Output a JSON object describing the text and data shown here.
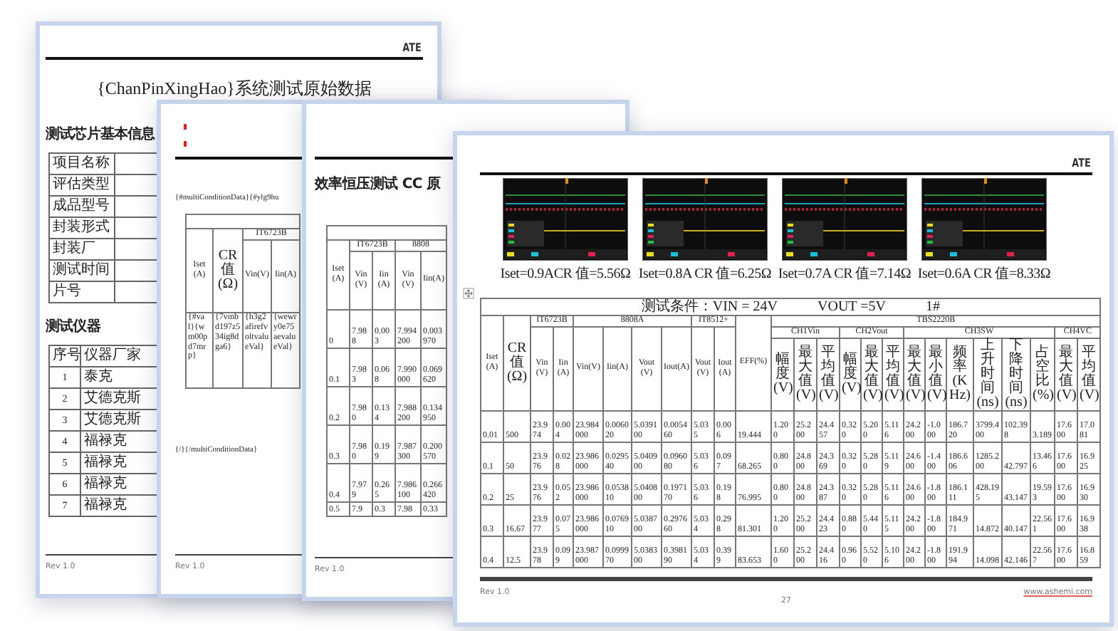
{
  "cover_page": {
    "header": "ATE",
    "title": "{ChanPinXingHao}系统测试原始数据",
    "chip_info": {
      "heading": "测试芯片基本信息",
      "rows": [
        {
          "label": "项目名称"
        },
        {
          "label": "评估类型"
        },
        {
          "label": "成品型号"
        },
        {
          "label": "封装形式"
        },
        {
          "label": "封装厂"
        },
        {
          "label": "测试时间"
        },
        {
          "label": "片号"
        }
      ]
    },
    "instruments": {
      "heading": "测试仪器",
      "columns": [
        "序号",
        "仪器厂家"
      ],
      "rows": [
        {
          "no": "1",
          "maker": "泰克"
        },
        {
          "no": "2",
          "maker": "艾德克斯"
        },
        {
          "no": "3",
          "maker": "艾德克斯"
        },
        {
          "no": "4",
          "maker": "福禄克"
        },
        {
          "no": "5",
          "maker": "福禄克"
        },
        {
          "no": "6",
          "maker": "福禄克"
        },
        {
          "no": "7",
          "maker": "福禄克"
        }
      ]
    },
    "footer": "Rev 1.0"
  },
  "template_page": {
    "loop_start": "{#multiConditionData}{#ylg9hu",
    "table": {
      "lead_columns": [
        "Iset(A)",
        "CR值(Ω)"
      ],
      "groups": [
        {
          "label": "IT6723B",
          "columns": [
            "Vin(V)",
            "Iin(A)"
          ]
        }
      ],
      "rows": [
        [
          "{#val}{wm00pd7mrp}",
          "{7vmbd197z534ig8dga6}",
          "{h3g2afirefvoltvalueVal}",
          "{wewry0e75aevalueVal}"
        ]
      ]
    },
    "loop_end": "{/}{/multiConditionData}",
    "footer": "Rev 1.0"
  },
  "cc_test_page": {
    "title": "效率恒压测试 CC 原",
    "table": {
      "lead_columns": [
        "Iset(A)"
      ],
      "groups": [
        {
          "label": "IT6723B",
          "columns": [
            "Vin(V)",
            "Iin(A)"
          ]
        },
        {
          "label": "8808",
          "columns": [
            "Vin(V)",
            "Iin(A)"
          ]
        }
      ],
      "rows": [
        [
          "0",
          "7.988",
          "0.003",
          "7.994200",
          "0.003970"
        ],
        [
          "0.1",
          "7.983",
          "0.068",
          "7.990000",
          "0.069620"
        ],
        [
          "0.2",
          "7.980",
          "0.134",
          "7.988200",
          "0.134950"
        ],
        [
          "0.3",
          "7.980",
          "0.199",
          "7.987300",
          "0.200570"
        ],
        [
          "0.4",
          "7.979",
          "0.265",
          "7.986100",
          "0.266420"
        ],
        [
          "0.5",
          "7.9",
          "0.3",
          "7.98",
          "0.33"
        ]
      ]
    },
    "footer": "Rev 1.0"
  },
  "result_page": {
    "header": "ATE",
    "captures": [
      {
        "caption": "Iset=0.9ACR 值=5.56Ω"
      },
      {
        "caption": "Iset=0.8A CR 值=6.25Ω"
      },
      {
        "caption": "Iset=0.7A CR 值=7.14Ω"
      },
      {
        "caption": "Iset=0.6A CR 值=8.33Ω"
      }
    ],
    "table": {
      "condition": [
        "测试条件：VIN = 24V",
        "VOUT =5V",
        "1#"
      ],
      "lead_columns": [
        "Iset(A)",
        "CR值(Ω)"
      ],
      "groups": [
        {
          "label": "IT6723B",
          "columns": [
            "Vin(V)",
            "Iin(A)"
          ]
        },
        {
          "label": "8808A",
          "columns": [
            "Vin(V)",
            "Iin(A)",
            "Vout(V)",
            "Iout(A)"
          ]
        },
        {
          "label": "IT8512+",
          "columns": [
            "Vout(V)",
            "Iout(A)"
          ]
        }
      ],
      "eff_column": "EFF(%)",
      "scope": {
        "label": "TBS2220B",
        "channels": [
          {
            "label": "CH1Vin",
            "columns": [
              "幅度(V)",
              "最大值(V)",
              "平均值(V)"
            ]
          },
          {
            "label": "CH2Vout",
            "columns": [
              "幅度(V)",
              "最大值(V)",
              "平均值(V)"
            ]
          },
          {
            "label": "CH3SW",
            "columns": [
              "最大值(V)",
              "最小值(V)",
              "频率(KHz)",
              "上升时间(ns)",
              "下降时间(ns)",
              "占空比(%)"
            ]
          },
          {
            "label": "CH4VC",
            "columns": [
              "最大值(V)",
              "平均值(V)"
            ]
          }
        ]
      },
      "rows": [
        [
          "0.01",
          "500",
          "23.974",
          "0.004",
          "23.984000",
          "0.006020",
          "5.039100",
          "0.005460",
          "5.035",
          "0.006",
          "19.444",
          "1.200",
          "25.200",
          "24.457",
          "0.320",
          "5.200",
          "5.116",
          "24.200",
          "-1.000",
          "186.720",
          "3799.400",
          "102.398",
          "3.189",
          "17.600",
          "17.081"
        ],
        [
          "0.1",
          "50",
          "23.976",
          "0.028",
          "23.986000",
          "0.029540",
          "5.040900",
          "0.096080",
          "5.036",
          "0.097",
          "68.265",
          "0.800",
          "24.800",
          "24.369",
          "0.320",
          "5.280",
          "5.119",
          "24.600",
          "-1.400",
          "186.606",
          "1285.200",
          "42.797",
          "13.466",
          "17.600",
          "16.925"
        ],
        [
          "0.2",
          "25",
          "23.976",
          "0.052",
          "23.986000",
          "0.053810",
          "5.040800",
          "0.197170",
          "5.036",
          "0.198",
          "76.995",
          "0.800",
          "24.800",
          "24.387",
          "0.320",
          "5.280",
          "5.116",
          "24.600",
          "-1.800",
          "186.111",
          "428.195",
          "43.147",
          "19.593",
          "17.600",
          "16.930"
        ],
        [
          "0.3",
          "16.67",
          "23.977",
          "0.075",
          "23.986000",
          "0.076910",
          "5.038700",
          "0.297660",
          "5.034",
          "0.298",
          "81.301",
          "1.200",
          "25.200",
          "24.423",
          "0.880",
          "5.440",
          "5.115",
          "24.200",
          "-1.800",
          "184.971",
          "14.872",
          "40.147",
          "22.561",
          "17.600",
          "16.938"
        ],
        [
          "0.4",
          "12.5",
          "23.978",
          "0.099",
          "23.987000",
          "0.099970",
          "5.038300",
          "0.398190",
          "5.034",
          "0.399",
          "83.653",
          "1.600",
          "25.200",
          "24.416",
          "0.960",
          "5.520",
          "5.106",
          "24.200",
          "-1.800",
          "191.994",
          "14.098",
          "42.146",
          "22.567",
          "17.600",
          "16.859"
        ]
      ]
    },
    "footer": "Rev 1.0",
    "page_number": "27",
    "url": "www.ashemi.com"
  }
}
